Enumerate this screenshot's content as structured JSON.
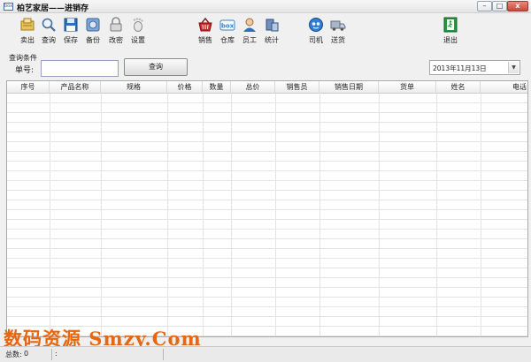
{
  "window": {
    "title": "柏艺家居——进销存",
    "app_icon_text": "box",
    "min_symbol": "–",
    "max_symbol": "□",
    "close_symbol": "x"
  },
  "toolbar": {
    "sell": "卖出",
    "query": "查询",
    "save": "保存",
    "backup": "备份",
    "change_password": "改密",
    "settings": "设置",
    "sales": "销售",
    "warehouse": "仓库",
    "staff": "员工",
    "statistics": "统计",
    "driver": "司机",
    "delivery": "送货",
    "exit": "退出"
  },
  "query": {
    "group_title": "查询条件",
    "order_label": "单号:",
    "order_value": "",
    "button_label": "查询",
    "date": "2013年11月13日",
    "date_arrow": "▼"
  },
  "table": {
    "columns": [
      "序号",
      "产品名称",
      "规格",
      "价格",
      "数量",
      "总价",
      "销售员",
      "销售日期",
      "货单",
      "姓名",
      "电话"
    ],
    "rows": []
  },
  "watermark": "数码资源 Smzy.Com",
  "status": {
    "total_label": "总数:",
    "total_value": "0",
    "second_panel": ":"
  },
  "colors": {
    "accent": "#2a5fa8",
    "watermark": "#e8660e",
    "close_button": "#c74a36"
  }
}
